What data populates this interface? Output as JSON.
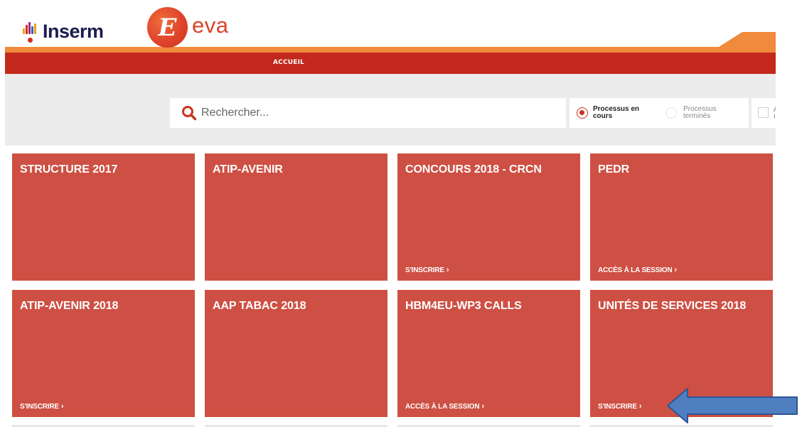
{
  "header": {
    "inserm_logo_text": "Inserm",
    "eva_logo_letter": "E",
    "eva_logo_text": "eva"
  },
  "nav": {
    "items": [
      {
        "label": "ACCUEIL"
      }
    ]
  },
  "search": {
    "placeholder": "Rechercher...",
    "icon": "search-icon"
  },
  "filters": {
    "in_progress": {
      "line1": "Processus en",
      "line2": "cours",
      "selected": true
    },
    "finished": {
      "line1": "Processus",
      "line2": "terminés",
      "selected": false
    },
    "third_cut": "A\nI"
  },
  "cards": [
    {
      "title": "STRUCTURE 2017",
      "link": ""
    },
    {
      "title": "ATIP-AVENIR",
      "link": ""
    },
    {
      "title": "CONCOURS 2018 - CRCN",
      "link": "S'INSCRIRE"
    },
    {
      "title": "PEDR",
      "link": "ACCÈS À LA SESSION"
    },
    {
      "title": "ATIP-AVENIR 2018",
      "link": "S'INSCRIRE"
    },
    {
      "title": "AAP TABAC 2018",
      "link": ""
    },
    {
      "title": "HBM4EU-WP3 CALLS",
      "link": "ACCÈS À LA SESSION"
    },
    {
      "title": "UNITÉS DE SERVICES 2018",
      "link": "S'INSCRIRE"
    }
  ],
  "colors": {
    "brand_red": "#c3281c",
    "card_red": "#ce5044",
    "orange_accent": "#f08a3c",
    "annotation_arrow": "#4f7fc0"
  },
  "link_chevron": "›"
}
